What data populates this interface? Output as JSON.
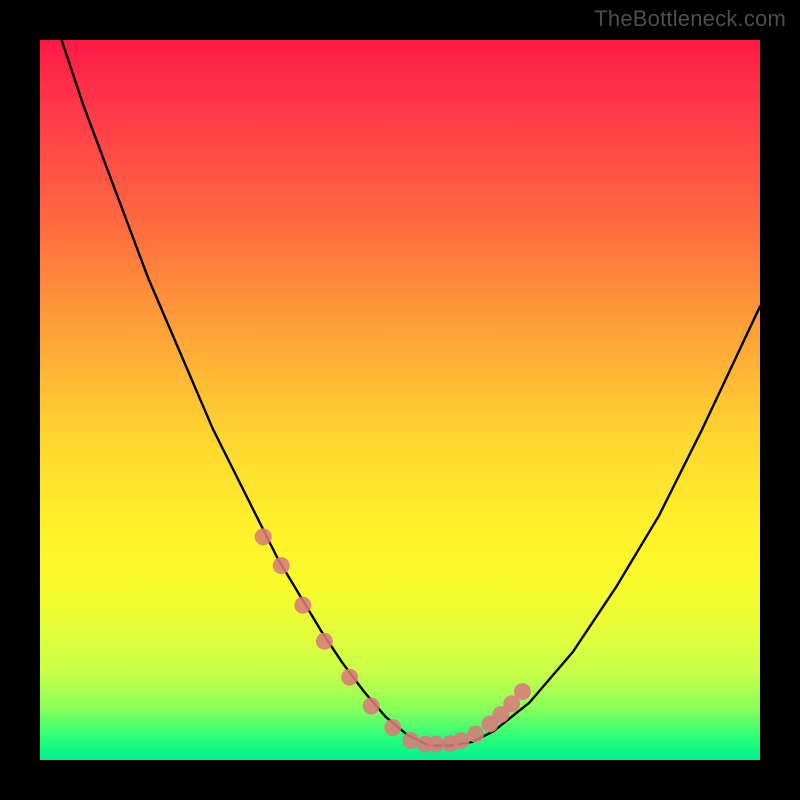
{
  "watermark": "TheBottleneck.com",
  "chart_data": {
    "type": "line",
    "title": "",
    "xlabel": "",
    "ylabel": "",
    "xlim": [
      0,
      100
    ],
    "ylim": [
      0,
      100
    ],
    "grid": false,
    "legend": false,
    "background": "red-yellow-green vertical gradient",
    "series": [
      {
        "name": "curve",
        "color": "#000000",
        "x": [
          0,
          3,
          6,
          9,
          12,
          15,
          18,
          21,
          24,
          27,
          30,
          33,
          36,
          39,
          42,
          45,
          48,
          51,
          54,
          57,
          60,
          63,
          68,
          74,
          80,
          86,
          92,
          100
        ],
        "y": [
          110,
          100,
          91,
          83,
          75,
          67,
          60,
          53,
          46,
          40,
          34,
          28,
          23,
          18,
          13.5,
          9.5,
          6,
          3.5,
          2,
          2,
          2.5,
          4,
          8,
          15,
          24,
          34,
          46,
          63
        ]
      },
      {
        "name": "markers",
        "color": "#d97b7b",
        "marker": "circle",
        "x": [
          31,
          33.5,
          36.5,
          39.5,
          43,
          46,
          49,
          51.5,
          53.5,
          55,
          57,
          58.5,
          60.5,
          62.5,
          64,
          65.5,
          67
        ],
        "y": [
          31,
          27,
          21.5,
          16.5,
          11.5,
          7.5,
          4.5,
          2.7,
          2.2,
          2.2,
          2.3,
          2.7,
          3.6,
          5,
          6.3,
          7.8,
          9.5
        ]
      }
    ]
  }
}
